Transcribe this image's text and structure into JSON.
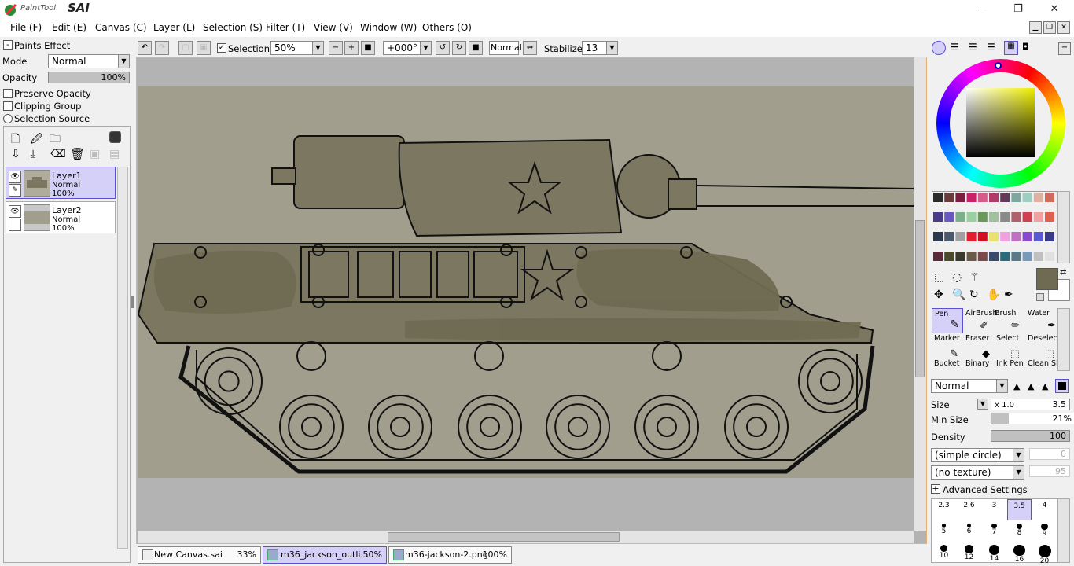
{
  "app": {
    "logo_small": "PaintTool",
    "logo_big": "SAI",
    "minimize": "—",
    "maximize": "❐",
    "close": "✕"
  },
  "menu": [
    "File (F)",
    "Edit (E)",
    "Canvas (C)",
    "Layer (L)",
    "Selection (S)",
    "Filter (T)",
    "View (V)",
    "Window (W)",
    "Others (O)"
  ],
  "toolbar": {
    "selection_label": "Selection",
    "zoom": "50%",
    "rotation": "+000°",
    "blend": "Normal",
    "stabilizer_label": "Stabilizer",
    "stabilizer": "13"
  },
  "paints_effect": {
    "title": "Paints Effect",
    "mode_label": "Mode",
    "mode": "Normal",
    "opacity_label": "Opacity",
    "opacity": "100%",
    "opacity_pct": 100,
    "preserve": "Preserve Opacity",
    "clipping": "Clipping Group",
    "selection_source": "Selection Source"
  },
  "layers": [
    {
      "name": "Layer1",
      "mode": "Normal",
      "opacity": "100%"
    },
    {
      "name": "Layer2",
      "mode": "Normal",
      "opacity": "100%"
    }
  ],
  "tools": [
    "Pen",
    "AirBrush",
    "Brush",
    "Water",
    "Marker",
    "Eraser",
    "Select",
    "Deselect",
    "Bucket",
    "Binary",
    "Ink Pen",
    "Clean Sl"
  ],
  "brush": {
    "blend": "Normal",
    "size_label": "Size",
    "size_mult": "x 1.0",
    "size": "3.5",
    "min_size_label": "Min Size",
    "min_size": "21%",
    "min_size_pct": 21,
    "density_label": "Density",
    "density": "100",
    "density_pct": 100,
    "shape": "(simple circle)",
    "shape_val": "0",
    "texture": "(no texture)",
    "texture_val": "95",
    "advanced": "Advanced Settings"
  },
  "brush_sizes": [
    "2.3",
    "2.6",
    "3",
    "3.5",
    "4",
    "5",
    "6",
    "7",
    "8",
    "9",
    "10",
    "12",
    "14",
    "16",
    "20"
  ],
  "tabs": [
    {
      "name": "New Canvas.sai",
      "zoom": "33%"
    },
    {
      "name": "m36_jackson_outli...",
      "zoom": "50%"
    },
    {
      "name": "m36-jackson-2.png",
      "zoom": "100%"
    }
  ],
  "colors": {
    "accent": "#d4d0f8",
    "canvas_bg": "#a19e8d",
    "tank": "#7c7761",
    "olive_main": "#6f6b52"
  }
}
